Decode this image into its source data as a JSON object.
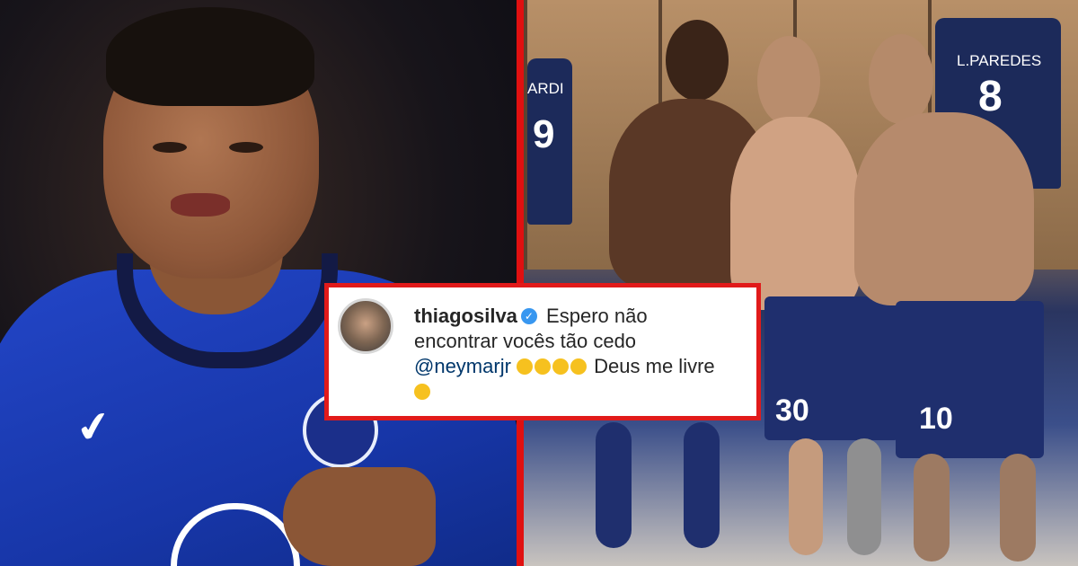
{
  "comment": {
    "username": "thiagosilva",
    "verified_icon": "verified-badge-icon",
    "text_line1": "Espero não",
    "text_line2": "encontrar vocês tão cedo",
    "mention": "@neymarjr",
    "emoji_icon": "laughing-face-emoji-icon",
    "emoji_count": 4,
    "text_tail": "Deus me livre",
    "trailing_emoji_icon": "smiling-face-emoji-icon"
  },
  "right_photo": {
    "jersey_left": {
      "name": "ARDI",
      "number": "9"
    },
    "jersey_right": {
      "name": "L.PAREDES",
      "number": "8"
    },
    "shorts_left_number": "30",
    "shorts_right_number": "10"
  },
  "colors": {
    "frame_red": "#e01010",
    "chelsea_blue": "#1736a8",
    "psg_navy": "#1c2a5a",
    "mention_blue": "#00376b",
    "verified_blue": "#3897f0"
  }
}
